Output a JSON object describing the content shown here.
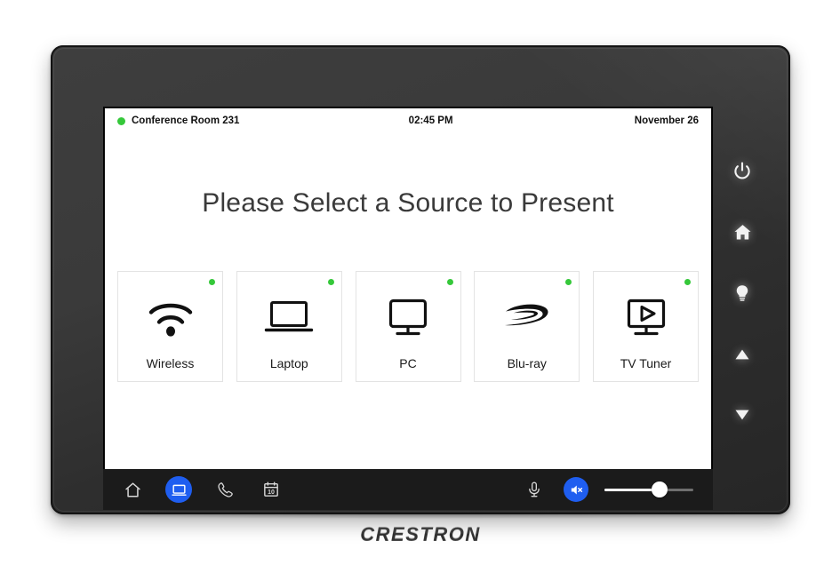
{
  "device": {
    "brand": "CRESTRON",
    "camera_icon": "camera-lens",
    "sensor_icon": "light-sensor"
  },
  "hardware_buttons": [
    {
      "name": "power",
      "icon": "power-icon"
    },
    {
      "name": "home",
      "icon": "home-icon"
    },
    {
      "name": "lights",
      "icon": "lightbulb-icon"
    },
    {
      "name": "up",
      "icon": "triangle-up-icon"
    },
    {
      "name": "down",
      "icon": "triangle-down-icon"
    }
  ],
  "statusbar": {
    "room_name": "Conference Room 231",
    "status_dot_color": "#35c83a",
    "time": "02:45 PM",
    "date": "November 26"
  },
  "main": {
    "title": "Please Select a Source to Present",
    "sources": [
      {
        "label": "Wireless",
        "icon": "wifi-icon",
        "available": true
      },
      {
        "label": "Laptop",
        "icon": "laptop-icon",
        "available": true
      },
      {
        "label": "PC",
        "icon": "monitor-icon",
        "available": true
      },
      {
        "label": "Blu-ray",
        "icon": "bluray-icon",
        "available": true
      },
      {
        "label": "TV Tuner",
        "icon": "tv-play-icon",
        "available": true
      }
    ]
  },
  "toolbar": {
    "accent_color": "#1f5ef0",
    "items": [
      {
        "name": "home",
        "icon": "home-outline-icon",
        "active": false
      },
      {
        "name": "present",
        "icon": "display-icon",
        "active": true
      },
      {
        "name": "call",
        "icon": "phone-icon",
        "active": false
      },
      {
        "name": "calendar",
        "icon": "calendar-icon",
        "active": false,
        "day": "10"
      }
    ],
    "microphone": {
      "name": "microphone",
      "icon": "microphone-icon",
      "muted": false
    },
    "speaker": {
      "name": "speaker-mute",
      "icon": "speaker-mute-icon",
      "muted": true
    },
    "volume": {
      "name": "volume-slider",
      "value": 62
    }
  }
}
